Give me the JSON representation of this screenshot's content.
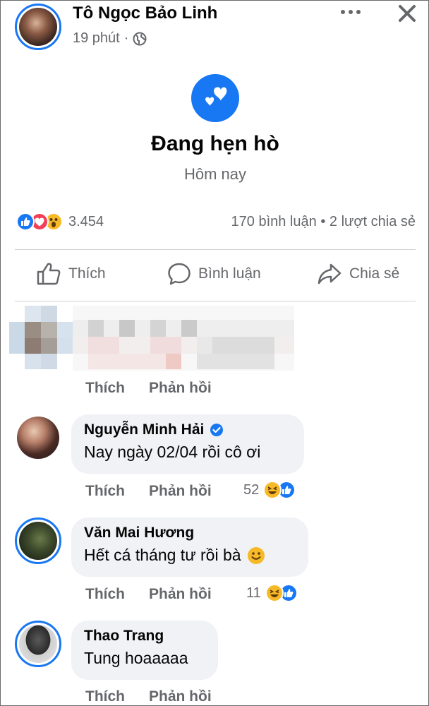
{
  "post": {
    "author": "Tô Ngọc Bảo Linh",
    "time": "19 phút",
    "separator": "·",
    "privacy_icon": "globe-icon"
  },
  "life_event": {
    "icon": "hearts-icon",
    "title": "Đang hẹn hò",
    "date": "Hôm nay"
  },
  "reactions": {
    "types": [
      "like",
      "love",
      "wow"
    ],
    "count": "3.454",
    "comments": "170 bình luận",
    "dot": "•",
    "shares": "2 lượt chia sẻ"
  },
  "actions": {
    "like": "Thích",
    "comment": "Bình luận",
    "share": "Chia sẻ"
  },
  "comments": [
    {
      "name": "",
      "text": "",
      "like_label": "Thích",
      "reply_label": "Phản hồi"
    },
    {
      "name": "Nguyễn Minh Hải",
      "verified": true,
      "text": "Nay ngày 02/04 rồi cô ơi",
      "like_label": "Thích",
      "reply_label": "Phản hồi",
      "reaction_count": "52",
      "reactions": [
        "haha",
        "like"
      ]
    },
    {
      "name": "Văn Mai Hương",
      "text": "Hết cá tháng tư rồi bà",
      "emoji": "smile-emoji",
      "like_label": "Thích",
      "reply_label": "Phản hồi",
      "reaction_count": "11",
      "reactions": [
        "haha",
        "like"
      ]
    },
    {
      "name": "Thao Trang",
      "text": "Tung hoaaaaa",
      "like_label": "Thích",
      "reply_label": "Phản hồi"
    }
  ],
  "colors": {
    "accent": "#1877f2",
    "love": "#f33e58",
    "haha": "#f7b928",
    "muted": "#65676b",
    "bubble": "#f0f2f5"
  }
}
